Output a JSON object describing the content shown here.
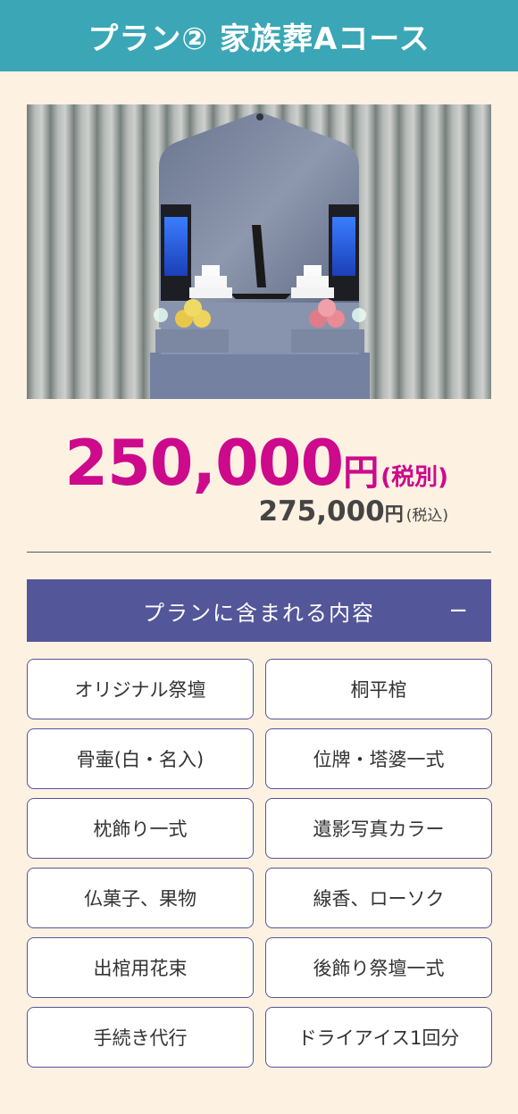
{
  "header": {
    "title": "プラン② 家族葬Aコース"
  },
  "photo": {
    "label": "altar-photo"
  },
  "price": {
    "main_amount": "250,000",
    "main_yen": "円",
    "main_tax_note": "(税別)",
    "sub_amount": "275,000",
    "sub_yen": "円",
    "sub_tax_note": "(税込)"
  },
  "accordion": {
    "title": "プランに含まれる内容",
    "toggle": "−"
  },
  "items": [
    "オリジナル祭壇",
    "桐平棺",
    "骨壷(白・名入)",
    "位牌・塔婆一式",
    "枕飾り一式",
    "遺影写真カラー",
    "仏菓子、果物",
    "線香、ローソク",
    "出棺用花束",
    "後飾り祭壇一式",
    "手続き代行",
    "ドライアイス1回分"
  ],
  "colors": {
    "header_bg": "#3aa6b6",
    "page_bg": "#fdf1e2",
    "price_accent": "#cc0a8b",
    "accordion_bg": "#54569a"
  }
}
